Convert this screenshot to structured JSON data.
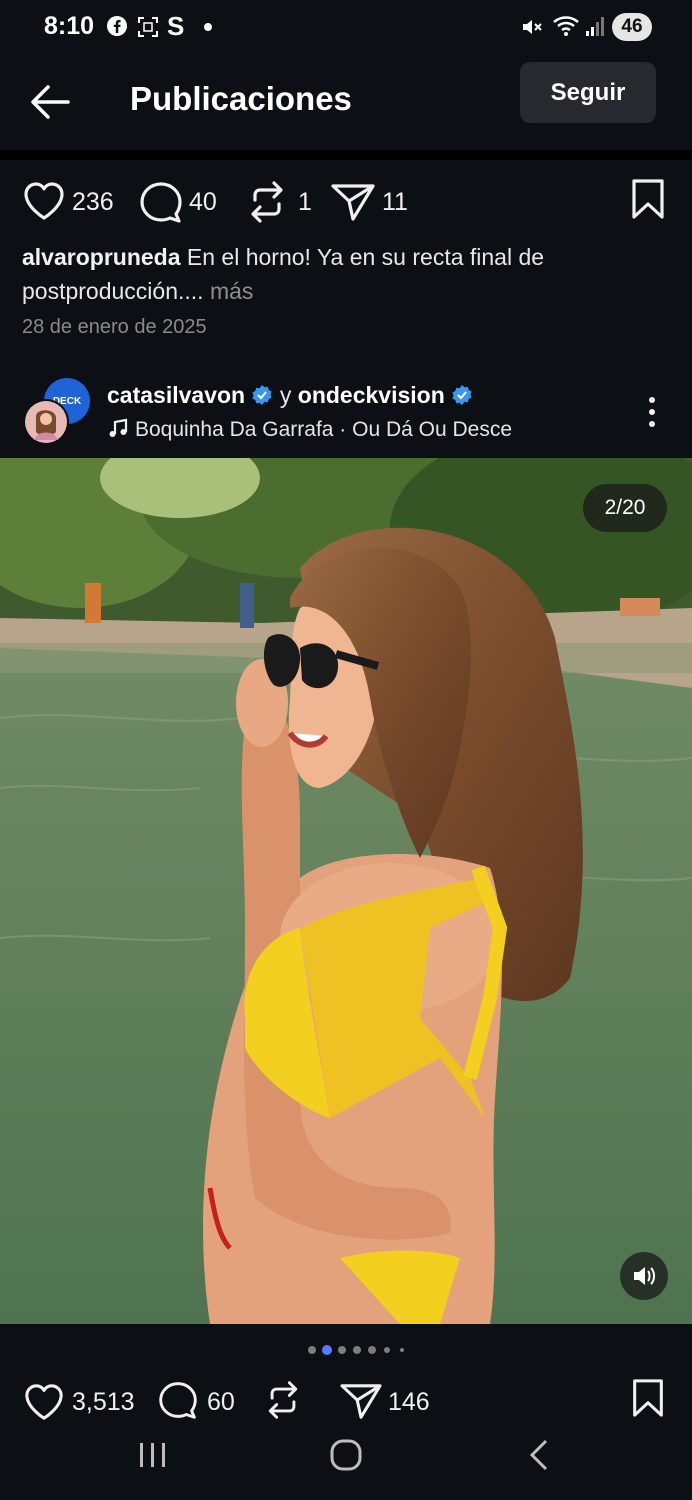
{
  "status_bar": {
    "time": "8:10",
    "battery": "46",
    "left_icons": [
      "facebook-icon",
      "screenshot-icon",
      "s-app-icon",
      "notification-dot-icon"
    ],
    "right_icons": [
      "mute-icon",
      "wifi-icon",
      "signal-icon"
    ]
  },
  "header": {
    "title": "Publicaciones",
    "follow_label": "Seguir",
    "back_icon": "arrow-left-icon"
  },
  "top_post": {
    "likes": "236",
    "comments": "40",
    "reposts": "1",
    "shares": "11",
    "caption_user": "alvaropruneda",
    "caption_text": "En el horno! Ya en su recta final de postproducción....",
    "more_label": "más",
    "date": "28 de enero de 2025"
  },
  "post": {
    "author": "catasilvavon",
    "connector": "y",
    "coauthor": "ondeckvision",
    "coauthor_avatar_text": "DECK",
    "song": "Boquinha Da Garrafa · Ou Dá Ou Desce",
    "media_counter": "2/20",
    "carousel_total_dots": 7,
    "carousel_active_index": 1,
    "likes": "3,513",
    "comments": "60",
    "shares": "146"
  },
  "colors": {
    "background": "#0c1014",
    "verified": "#3897f0",
    "active_dot": "#5b7cff",
    "bikini": "#f3cf20"
  }
}
